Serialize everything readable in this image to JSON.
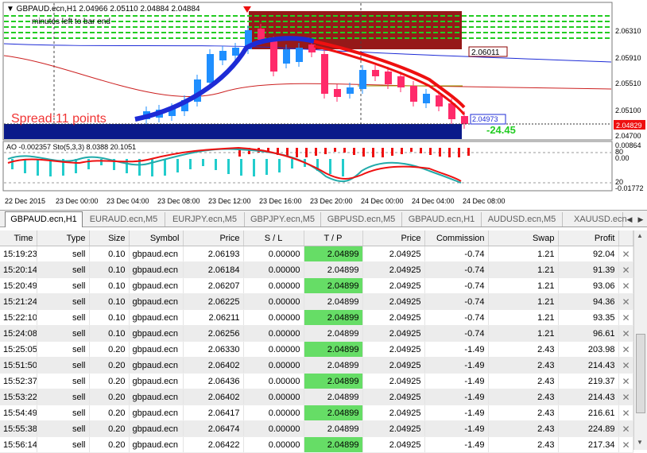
{
  "chart": {
    "header": "▼ GBPAUD.ecn,H1  2.04966 2.05110 2.04884 2.04884",
    "countdown": "minutes left to bar end",
    "big_label": "Spread:11 points",
    "target_label": "-24.45",
    "price_ticks": [
      "2.06310",
      "2.05910",
      "2.05510",
      "2.05100",
      "2.04700"
    ],
    "price_tags": {
      "resistance": "2.06011",
      "bid": "2.04973",
      "current": "2.04829"
    },
    "indicator_label": "AO -0.002357  Sto(5,3,3) 8.0388 20.1051",
    "ind_ticks": [
      "0.00864",
      "80",
      "0.00",
      "20",
      "-0.01772"
    ],
    "time_labels": [
      "22 Dec 2015",
      "23 Dec 00:00",
      "23 Dec 04:00",
      "23 Dec 08:00",
      "23 Dec 12:00",
      "23 Dec 16:00",
      "23 Dec 20:00",
      "24 Dec 00:00",
      "24 Dec 04:00",
      "24 Dec 08:00"
    ],
    "colors": {
      "bull": "#1f8fff",
      "bear": "#ff2a6a",
      "ma_fast": "#1d2bd6",
      "ma_slow": "#ff1010",
      "green_line": "#22cc22",
      "zone": "#8b0000",
      "bar": "#0a1a8a"
    }
  },
  "tabs": [
    "GBPAUD.ecn,H1",
    "EURAUD.ecn,M5",
    "EURJPY.ecn,M5",
    "GBPJPY.ecn,M5",
    "GBPUSD.ecn,M5",
    "GBPAUD.ecn,H1",
    "AUDUSD.ecn,M5",
    "XAUUSD.ecn"
  ],
  "columns": [
    "Time",
    "Type",
    "Size",
    "Symbol",
    "Price",
    "S / L",
    "T / P",
    "Price",
    "Commission",
    "Swap",
    "Profit"
  ],
  "rows": [
    [
      "15:19:23",
      "sell",
      "0.10",
      "gbpaud.ecn",
      "2.06193",
      "0.00000",
      "2.04899",
      "2.04925",
      "-0.74",
      "1.21",
      "92.04"
    ],
    [
      "15:20:14",
      "sell",
      "0.10",
      "gbpaud.ecn",
      "2.06184",
      "0.00000",
      "2.04899",
      "2.04925",
      "-0.74",
      "1.21",
      "91.39"
    ],
    [
      "15:20:49",
      "sell",
      "0.10",
      "gbpaud.ecn",
      "2.06207",
      "0.00000",
      "2.04899",
      "2.04925",
      "-0.74",
      "1.21",
      "93.06"
    ],
    [
      "15:21:24",
      "sell",
      "0.10",
      "gbpaud.ecn",
      "2.06225",
      "0.00000",
      "2.04899",
      "2.04925",
      "-0.74",
      "1.21",
      "94.36"
    ],
    [
      "15:22:10",
      "sell",
      "0.10",
      "gbpaud.ecn",
      "2.06211",
      "0.00000",
      "2.04899",
      "2.04925",
      "-0.74",
      "1.21",
      "93.35"
    ],
    [
      "15:24:08",
      "sell",
      "0.10",
      "gbpaud.ecn",
      "2.06256",
      "0.00000",
      "2.04899",
      "2.04925",
      "-0.74",
      "1.21",
      "96.61"
    ],
    [
      "15:25:05",
      "sell",
      "0.20",
      "gbpaud.ecn",
      "2.06330",
      "0.00000",
      "2.04899",
      "2.04925",
      "-1.49",
      "2.43",
      "203.98"
    ],
    [
      "15:51:50",
      "sell",
      "0.20",
      "gbpaud.ecn",
      "2.06402",
      "0.00000",
      "2.04899",
      "2.04925",
      "-1.49",
      "2.43",
      "214.43"
    ],
    [
      "15:52:37",
      "sell",
      "0.20",
      "gbpaud.ecn",
      "2.06436",
      "0.00000",
      "2.04899",
      "2.04925",
      "-1.49",
      "2.43",
      "219.37"
    ],
    [
      "15:53:22",
      "sell",
      "0.20",
      "gbpaud.ecn",
      "2.06402",
      "0.00000",
      "2.04899",
      "2.04925",
      "-1.49",
      "2.43",
      "214.43"
    ],
    [
      "15:54:49",
      "sell",
      "0.20",
      "gbpaud.ecn",
      "2.06417",
      "0.00000",
      "2.04899",
      "2.04925",
      "-1.49",
      "2.43",
      "216.61"
    ],
    [
      "15:55:38",
      "sell",
      "0.20",
      "gbpaud.ecn",
      "2.06474",
      "0.00000",
      "2.04899",
      "2.04925",
      "-1.49",
      "2.43",
      "224.89"
    ],
    [
      "15:56:14",
      "sell",
      "0.20",
      "gbpaud.ecn",
      "2.06422",
      "0.00000",
      "2.04899",
      "2.04925",
      "-1.49",
      "2.43",
      "217.34"
    ]
  ]
}
